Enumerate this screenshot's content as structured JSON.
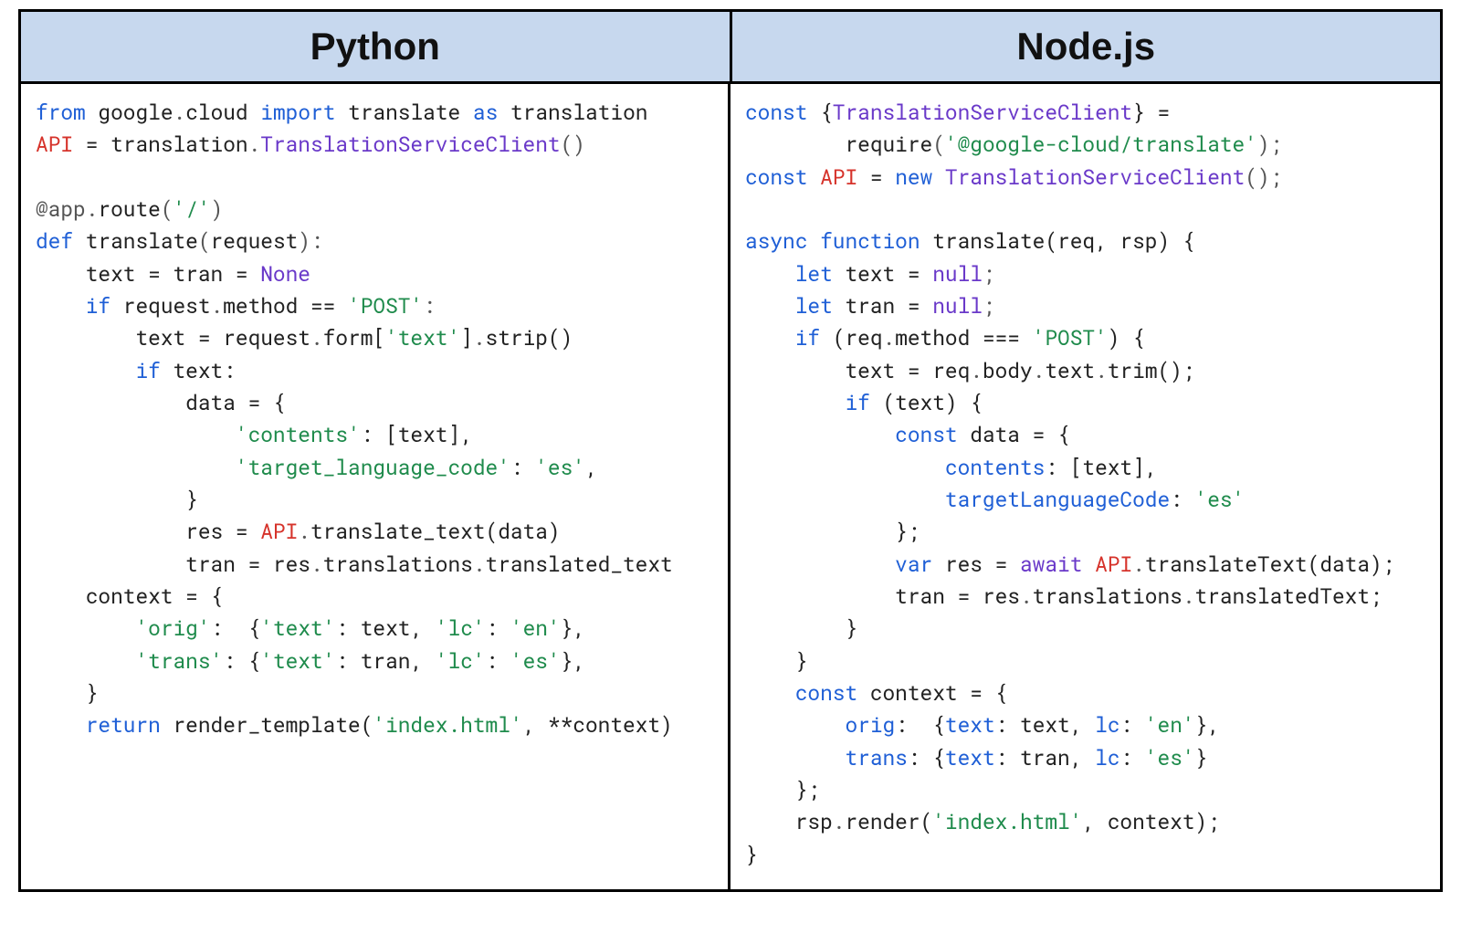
{
  "headers": {
    "left": "Python",
    "right": "Node.js"
  },
  "code": {
    "python": {
      "l1_from": "from",
      "l1_google": "google",
      "l1_dot1": ".",
      "l1_cloud": "cloud",
      "l1_import": "import",
      "l1_translate": "translate",
      "l1_as": "as",
      "l1_translation": "translation",
      "l2_api": "API",
      "l2_eq": " = ",
      "l2_translation": "translation",
      "l2_dot": ".",
      "l2_cls": "TranslationServiceClient",
      "l2_parens": "()",
      "l3_at": "@app",
      "l3_dot": ".",
      "l3_route": "route",
      "l3_open": "(",
      "l3_str": "'/'",
      "l3_close": ")",
      "l4_def": "def",
      "l4_name": "translate",
      "l4_open": "(",
      "l4_req": "request",
      "l4_close": "):",
      "l5": "    text = tran = ",
      "l5_none": "None",
      "l6_if": "    if",
      "l6_rest": " request",
      "l6_dot": ".",
      "l6_method": "method == ",
      "l6_str": "'POST'",
      "l6_colon": ":",
      "l7": "        text = request",
      "l7_dot1": ".",
      "l7_form": "form[",
      "l7_str": "'text'",
      "l7_close": "]",
      "l7_dot2": ".",
      "l7_strip": "strip()",
      "l8_if": "        if",
      "l8_rest": " text:",
      "l9": "            data = {",
      "l10_pad": "                ",
      "l10_str": "'contents'",
      "l10_colon": ": [text],",
      "l11_pad": "                ",
      "l11_str": "'target_language_code'",
      "l11_colon": ": ",
      "l11_str2": "'es'",
      "l11_comma": ",",
      "l12": "            }",
      "l13_pad": "            res = ",
      "l13_api": "API",
      "l13_dot": ".",
      "l13_call": "translate_text(data)",
      "l14": "            tran = res",
      "l14_dot1": ".",
      "l14_tr": "translations",
      "l14_dot2": ".",
      "l14_tt": "translated_text",
      "l15": "    context = {",
      "l16_pad": "        ",
      "l16_key": "'orig'",
      "l16_colon": ":  {",
      "l16_k1": "'text'",
      "l16_c1": ": text, ",
      "l16_k2": "'lc'",
      "l16_c2": ": ",
      "l16_v2": "'en'",
      "l16_end": "},",
      "l17_pad": "        ",
      "l17_key": "'trans'",
      "l17_colon": ": {",
      "l17_k1": "'text'",
      "l17_c1": ": tran, ",
      "l17_k2": "'lc'",
      "l17_c2": ": ",
      "l17_v2": "'es'",
      "l17_end": "},",
      "l18": "    }",
      "l19_ret": "    return",
      "l19_call": " render_template(",
      "l19_str": "'index.html'",
      "l19_rest": ", **context)"
    },
    "node": {
      "l1_const": "const",
      "l1_brace": " {",
      "l1_cls": "TranslationServiceClient",
      "l1_close": "} =",
      "l2_pad": "        ",
      "l2_req": "require",
      "l2_open": "(",
      "l2_str": "'@google-cloud/translate'",
      "l2_close": ");",
      "l3_const": "const",
      "l3_sp": " ",
      "l3_api": "API",
      "l3_eq": " = ",
      "l3_new": "new",
      "l3_sp2": " ",
      "l3_cls": "TranslationServiceClient",
      "l3_parens": "();",
      "l4_async": "async",
      "l4_fn": " function",
      "l4_name": " translate",
      "l4_args": "(req, rsp) {",
      "l5_let": "    let",
      "l5_rest": " text = ",
      "l5_null": "null",
      "l5_semi": ";",
      "l6_let": "    let",
      "l6_rest": " tran = ",
      "l6_null": "null",
      "l6_semi": ";",
      "l7_if": "    if",
      "l7_open": " (req",
      "l7_dot": ".",
      "l7_method": "method === ",
      "l7_str": "'POST'",
      "l7_close": ") {",
      "l8": "        text = req",
      "l8_dot1": ".",
      "l8_body": "body",
      "l8_dot2": ".",
      "l8_text": "text",
      "l8_dot3": ".",
      "l8_trim": "trim();",
      "l9_if": "        if",
      "l9_rest": " (text) {",
      "l10_const": "            const",
      "l10_rest": " data = {",
      "l11_pad": "                ",
      "l11_key": "contents",
      "l11_rest": ": [text],",
      "l12_pad": "                ",
      "l12_key": "targetLanguageCode",
      "l12_colon": ": ",
      "l12_str": "'es'",
      "l13": "            };",
      "l14_var": "            var",
      "l14_rest": " res = ",
      "l14_await": "await",
      "l14_sp": " ",
      "l14_api": "API",
      "l14_dot": ".",
      "l14_call": "translateText(data);",
      "l15": "            tran = res",
      "l15_dot1": ".",
      "l15_tr": "translations",
      "l15_dot2": ".",
      "l15_tt": "translatedText;",
      "l16": "        }",
      "l17": "    }",
      "l18_const": "    const",
      "l18_rest": " context = {",
      "l19_pad": "        ",
      "l19_key": "orig",
      "l19_colon": ":  {",
      "l19_k1": "text",
      "l19_c1": ": text, ",
      "l19_k2": "lc",
      "l19_c2": ": ",
      "l19_v2": "'en'",
      "l19_end": "},",
      "l20_pad": "        ",
      "l20_key": "trans",
      "l20_colon": ": {",
      "l20_k1": "text",
      "l20_c1": ": tran, ",
      "l20_k2": "lc",
      "l20_c2": ": ",
      "l20_v2": "'es'",
      "l20_end": "}",
      "l21": "    };",
      "l22_pad": "    rsp",
      "l22_dot": ".",
      "l22_render": "render(",
      "l22_str": "'index.html'",
      "l22_rest": ", context);",
      "l23": "}"
    }
  }
}
